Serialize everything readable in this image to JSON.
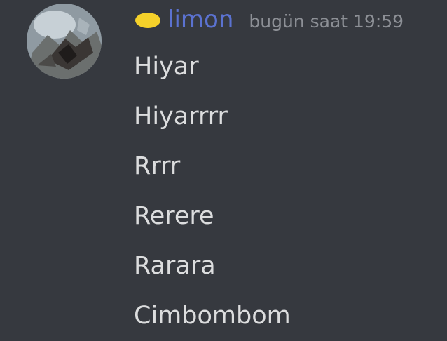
{
  "message": {
    "author": {
      "name": "limon",
      "status_color": "#f5d12a",
      "name_color": "#5b72d0"
    },
    "timestamp": "bugün saat 19:59",
    "lines": [
      "Hiyar",
      "Hiyarrrr",
      "Rrrr",
      "Rerere",
      "Rarara",
      "Cimbombom"
    ]
  }
}
